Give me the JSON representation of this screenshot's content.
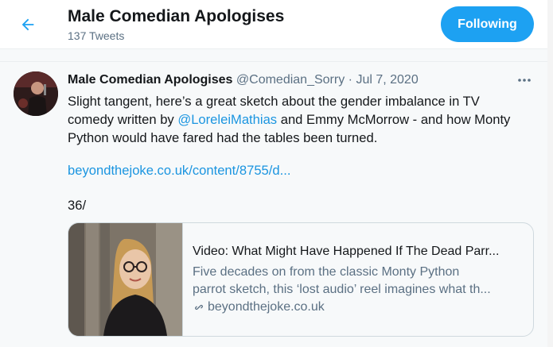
{
  "header": {
    "title": "Male Comedian Apologises",
    "tweet_count": "137 Tweets",
    "follow_label": "Following"
  },
  "tweet": {
    "author_name": "Male Comedian Apologises",
    "handle": "@Comedian_Sorry",
    "separator": "·",
    "date": "Jul 7, 2020",
    "text_line1": "Slight tangent, here’s a great sketch about the gender imbalance in TV",
    "text_line2_prefix": "comedy written by ",
    "mention": "@LoreleiMathias",
    "text_line2_suffix": " and Emmy McMorrow - and how Monty",
    "text_line3": "Python would have fared had the tables been turned.",
    "link": "beyondthejoke.co.uk/content/8755/d...",
    "thread_number": "36/",
    "card": {
      "title": "Video: What Might Have Happened If The Dead Parr...",
      "desc_line1": "Five decades on from the classic Monty Python",
      "desc_line2": "parrot sketch, this ‘lost audio’ reel imagines what th...",
      "domain": "beyondthejoke.co.uk"
    }
  },
  "icons": {
    "back": "arrow-left-icon",
    "more": "more-horizontal-icon",
    "link": "link-icon"
  },
  "colors": {
    "accent": "#1da1f2",
    "link": "#1b95e0",
    "secondary_text": "#5b7083"
  }
}
